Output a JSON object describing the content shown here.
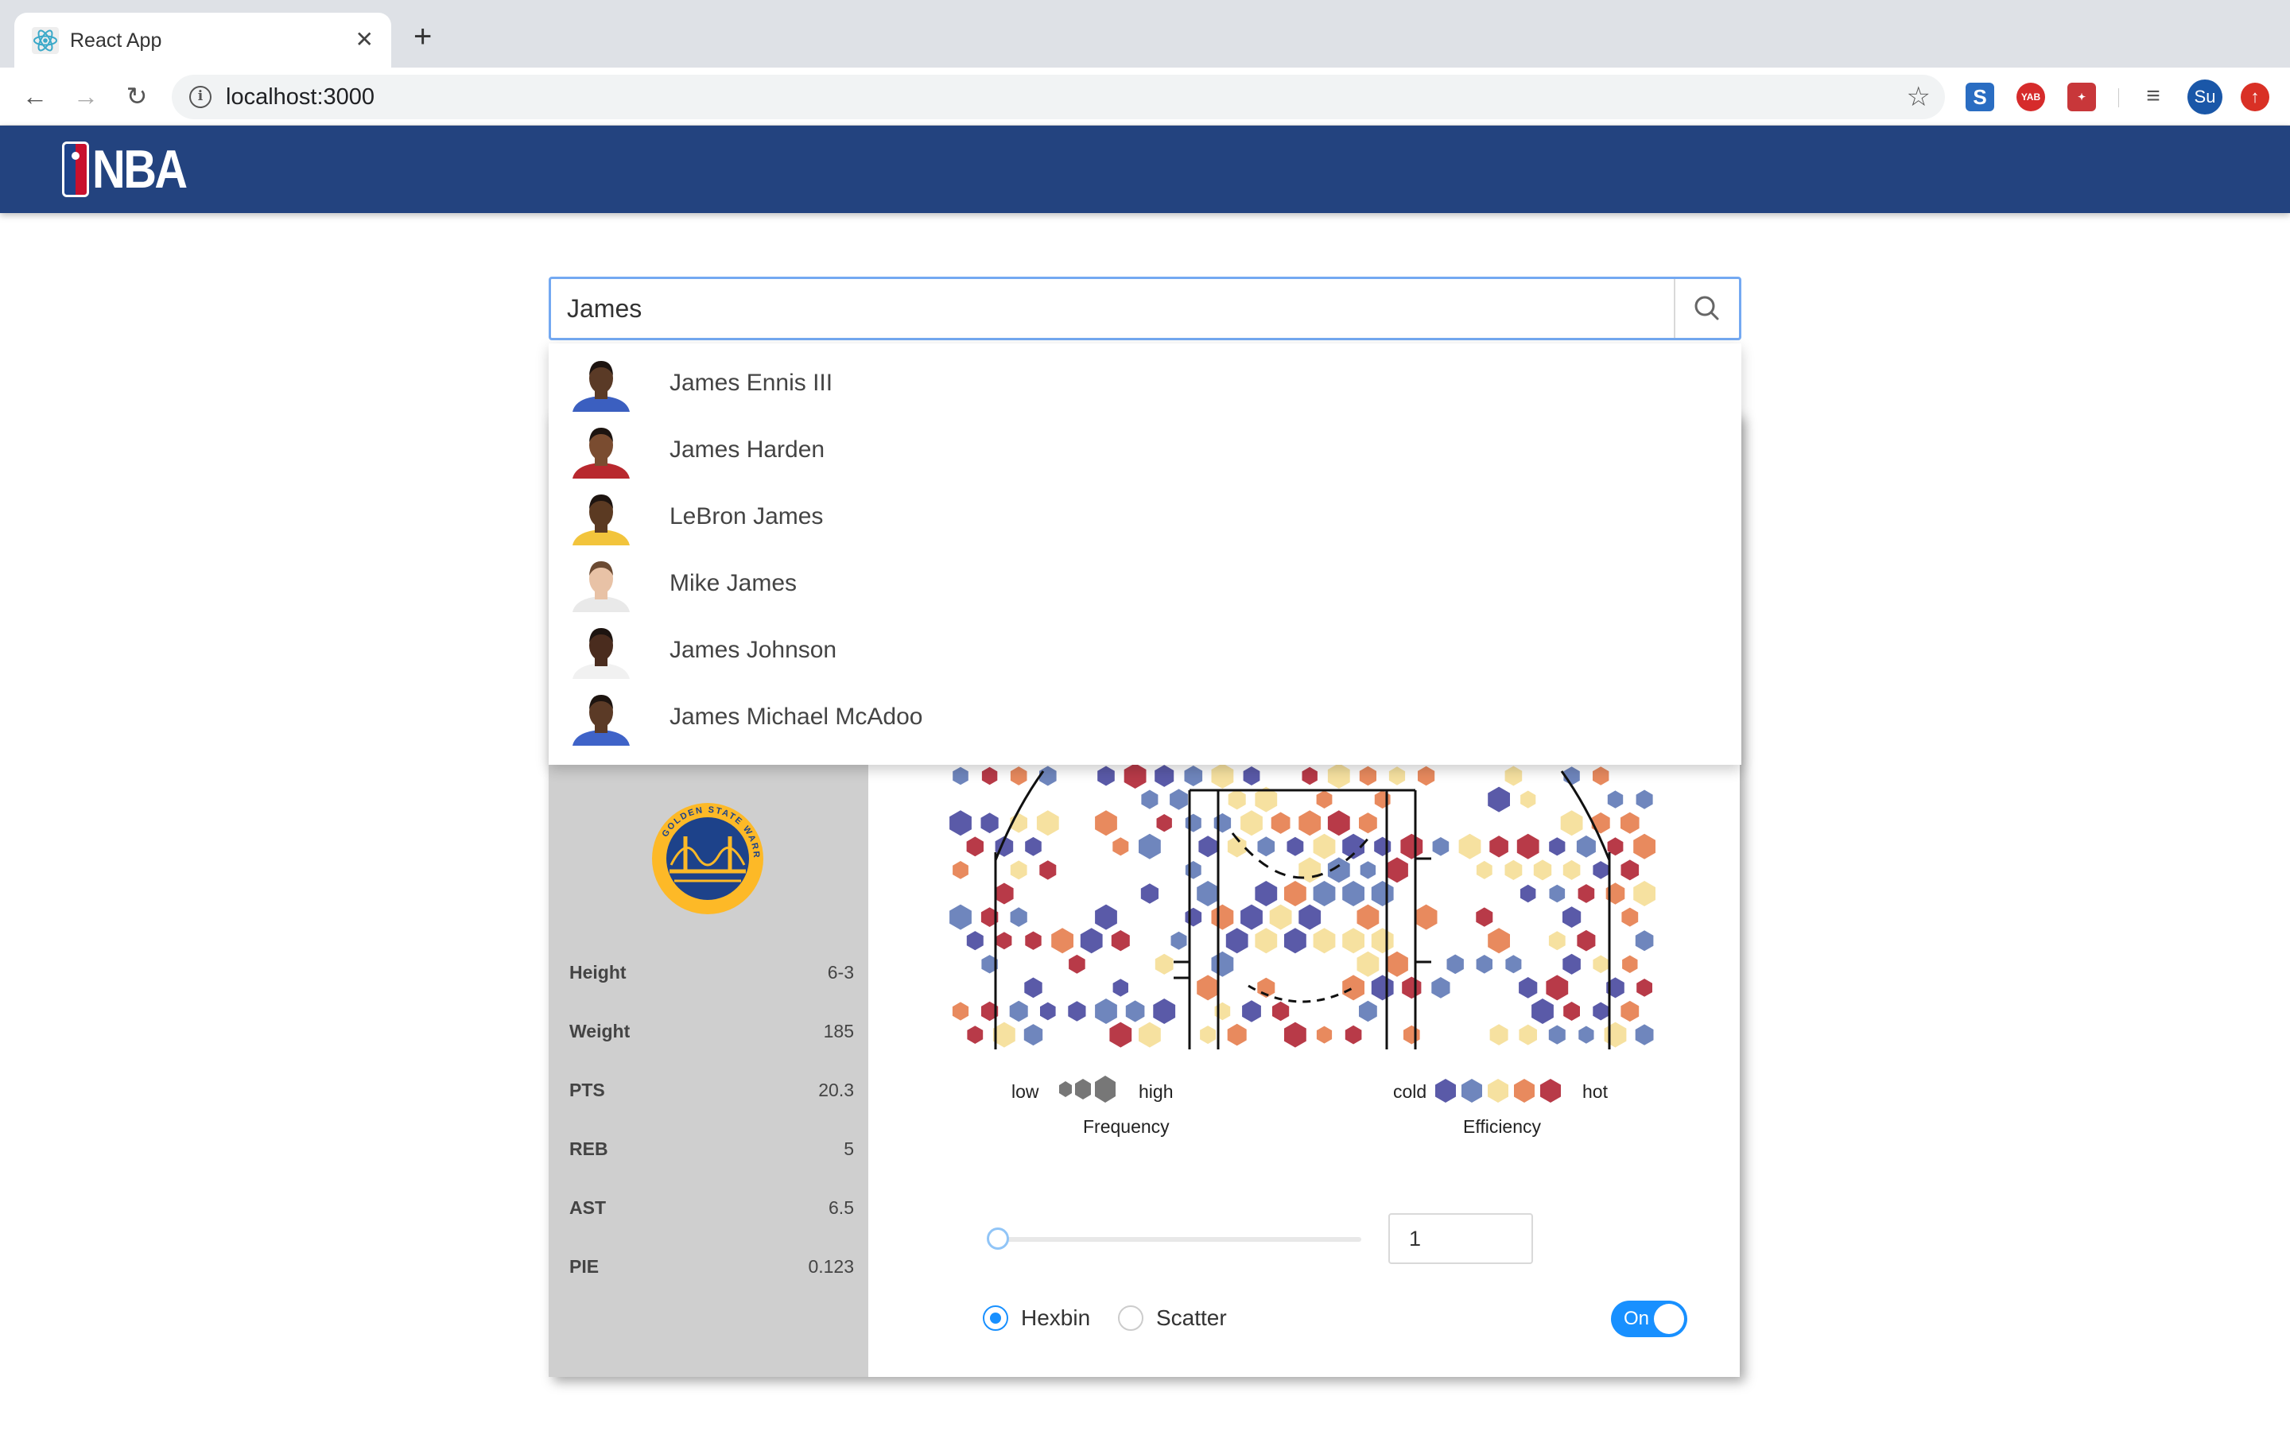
{
  "browser": {
    "tab_title": "React App",
    "tab_close": "✕",
    "new_tab": "+",
    "url": "localhost:3000",
    "ext_yab": "YAB",
    "profile_initials": "Su"
  },
  "header": {
    "logo_text": "NBA"
  },
  "search": {
    "value": "James",
    "results": [
      {
        "name": "James Ennis III",
        "skin": "#5a3a26",
        "hair": "#1d1410",
        "jersey": "#3b5fc0"
      },
      {
        "name": "James Harden",
        "skin": "#7a4c30",
        "hair": "#1d1410",
        "jersey": "#b8282e"
      },
      {
        "name": "LeBron James",
        "skin": "#5b3a22",
        "hair": "#1d1410",
        "jersey": "#f2c43c"
      },
      {
        "name": "Mike James",
        "skin": "#e8c2a6",
        "hair": "#6b4a32",
        "jersey": "#e9e9e9"
      },
      {
        "name": "James Johnson",
        "skin": "#4a2c1e",
        "hair": "#1d1410",
        "jersey": "#f1f1f1"
      },
      {
        "name": "James Michael McAdoo",
        "skin": "#5b3a26",
        "hair": "#1d1410",
        "jersey": "#3f63c8"
      }
    ]
  },
  "player": {
    "team_logo_text": "GOLDEN STATE WARRIORS",
    "stats": [
      {
        "label": "Height",
        "value": "6-3"
      },
      {
        "label": "Weight",
        "value": "185"
      },
      {
        "label": "PTS",
        "value": "20.3"
      },
      {
        "label": "REB",
        "value": "5"
      },
      {
        "label": "AST",
        "value": "6.5"
      },
      {
        "label": "PIE",
        "value": "0.123"
      }
    ]
  },
  "legend": {
    "freq_low": "low",
    "freq_high": "high",
    "freq_title": "Frequency",
    "eff_cold": "cold",
    "eff_hot": "hot",
    "eff_title": "Efficiency",
    "eff_colors": [
      "#5a5aa8",
      "#6f86bd",
      "#f6e1a0",
      "#e88a5e",
      "#b83a48"
    ]
  },
  "controls": {
    "min_count_value": "1",
    "slider_value": 0,
    "chart_type_options": [
      "Hexbin",
      "Scatter"
    ],
    "chart_type_selected": "Hexbin",
    "toggle_label": "On",
    "toggle_on": true
  }
}
